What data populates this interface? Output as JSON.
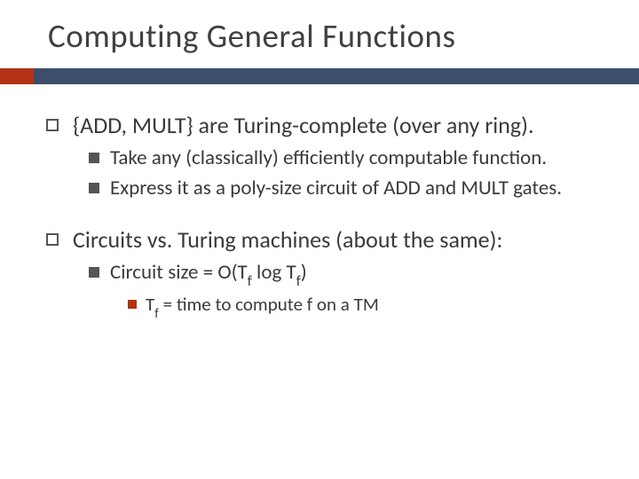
{
  "title": "Computing General Functions",
  "bullets": [
    {
      "text": "{ADD, MULT} are Turing-complete (over any ring).",
      "children": [
        {
          "text": "Take any (classically) efficiently computable function."
        },
        {
          "text": "Express it as a poly-size circuit of ADD and MULT gates."
        }
      ]
    },
    {
      "text": "Circuits vs. Turing machines (about the same):",
      "children": [
        {
          "text_prefix": "Circuit size = O(T",
          "sub1": "f",
          "mid": " log T",
          "sub2": "f",
          "suffix": ")",
          "children": [
            {
              "text_prefix": "T",
              "sub1": "f",
              "suffix": " = time to compute f on a TM"
            }
          ]
        }
      ]
    }
  ]
}
